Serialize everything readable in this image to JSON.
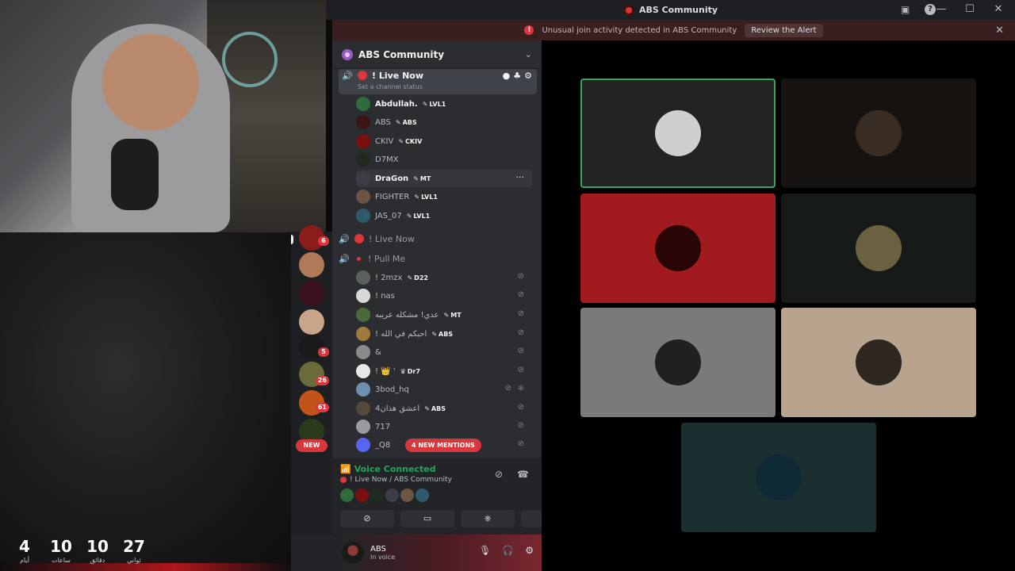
{
  "window": {
    "title": "ABS Community"
  },
  "alert": {
    "text": "Unusual join activity detected in ABS Community",
    "button": "Review the Alert"
  },
  "server": {
    "name": "ABS Community"
  },
  "channels": {
    "active": {
      "name": "! Live Now",
      "status_placeholder": "Set a channel status"
    },
    "second": {
      "name": "! Live Now"
    },
    "third": {
      "name": "! Pull Me"
    }
  },
  "live_users": [
    {
      "name": "Abdullah.",
      "tag": "LVL1",
      "color": "#2f6b3b"
    },
    {
      "name": "ABS",
      "tag": "ABS",
      "color": "#3a1616"
    },
    {
      "name": "CKIV",
      "tag": "CKIV",
      "color": "#7a1010"
    },
    {
      "name": "D7MX",
      "tag": "",
      "color": "#1e2a1e"
    },
    {
      "name": "DraGon",
      "tag": "MT",
      "color": "#3c3c44"
    },
    {
      "name": "FIGHTER",
      "tag": "LVL1",
      "color": "#6b5544"
    },
    {
      "name": "JAS_07",
      "tag": "LVL1",
      "color": "#2f5a6a"
    }
  ],
  "pull_users": [
    {
      "name": "! 2mzx",
      "tag": "D22",
      "color": "#57625c"
    },
    {
      "name": "! nas",
      "tag": "",
      "color": "#d8d8d8"
    },
    {
      "name": "عدي! مشكله عريبه",
      "tag": "MT",
      "color": "#4a6a3c"
    },
    {
      "name": "! احبكم في الله",
      "tag": "ABS",
      "color": "#a07a3a"
    },
    {
      "name": "&",
      "tag": "",
      "color": "#8a8a8a"
    },
    {
      "name": "! 👑 '",
      "tag": "Dr7",
      "color": "#e8e8e8"
    },
    {
      "name": "3bod_hq",
      "tag": "",
      "color": "#6f8fae"
    },
    {
      "name": "اعشق هذان4",
      "tag": "ABS",
      "color": "#55493a"
    },
    {
      "name": "717",
      "tag": "",
      "color": "#9a9aa0"
    },
    {
      "name": "_Q8",
      "tag": "",
      "color": "#5865f2"
    }
  ],
  "mentions": "4 NEW MENTIONS",
  "rail": {
    "badges": [
      "6",
      "5",
      "26",
      "61"
    ],
    "new_label": "NEW"
  },
  "voice": {
    "title": "Voice Connected",
    "location": "! Live Now / ABS Community"
  },
  "me": {
    "name": "ABS",
    "status": "In voice"
  },
  "tiles": [
    {
      "bg": "#232323",
      "av": "#cfcfcf",
      "speaking": true
    },
    {
      "bg": "#171311",
      "av": "#3a2e24",
      "speaking": false
    },
    {
      "bg": "#a11a1d",
      "av": "#2a0505",
      "speaking": false
    },
    {
      "bg": "#151a18",
      "av": "#6b6140",
      "speaking": false
    },
    {
      "bg": "#7a7a7a",
      "av": "#202020",
      "speaking": false
    },
    {
      "bg": "#b8a48e",
      "av": "#2e2620",
      "speaking": false
    },
    {
      "bg": "#1b2e30",
      "av": "#0f2a36",
      "speaking": false
    }
  ],
  "countdown": [
    {
      "num": "4",
      "label": "أيام"
    },
    {
      "num": "10",
      "label": "ساعات"
    },
    {
      "num": "10",
      "label": "دقائق"
    },
    {
      "num": "27",
      "label": "ثواني"
    }
  ]
}
